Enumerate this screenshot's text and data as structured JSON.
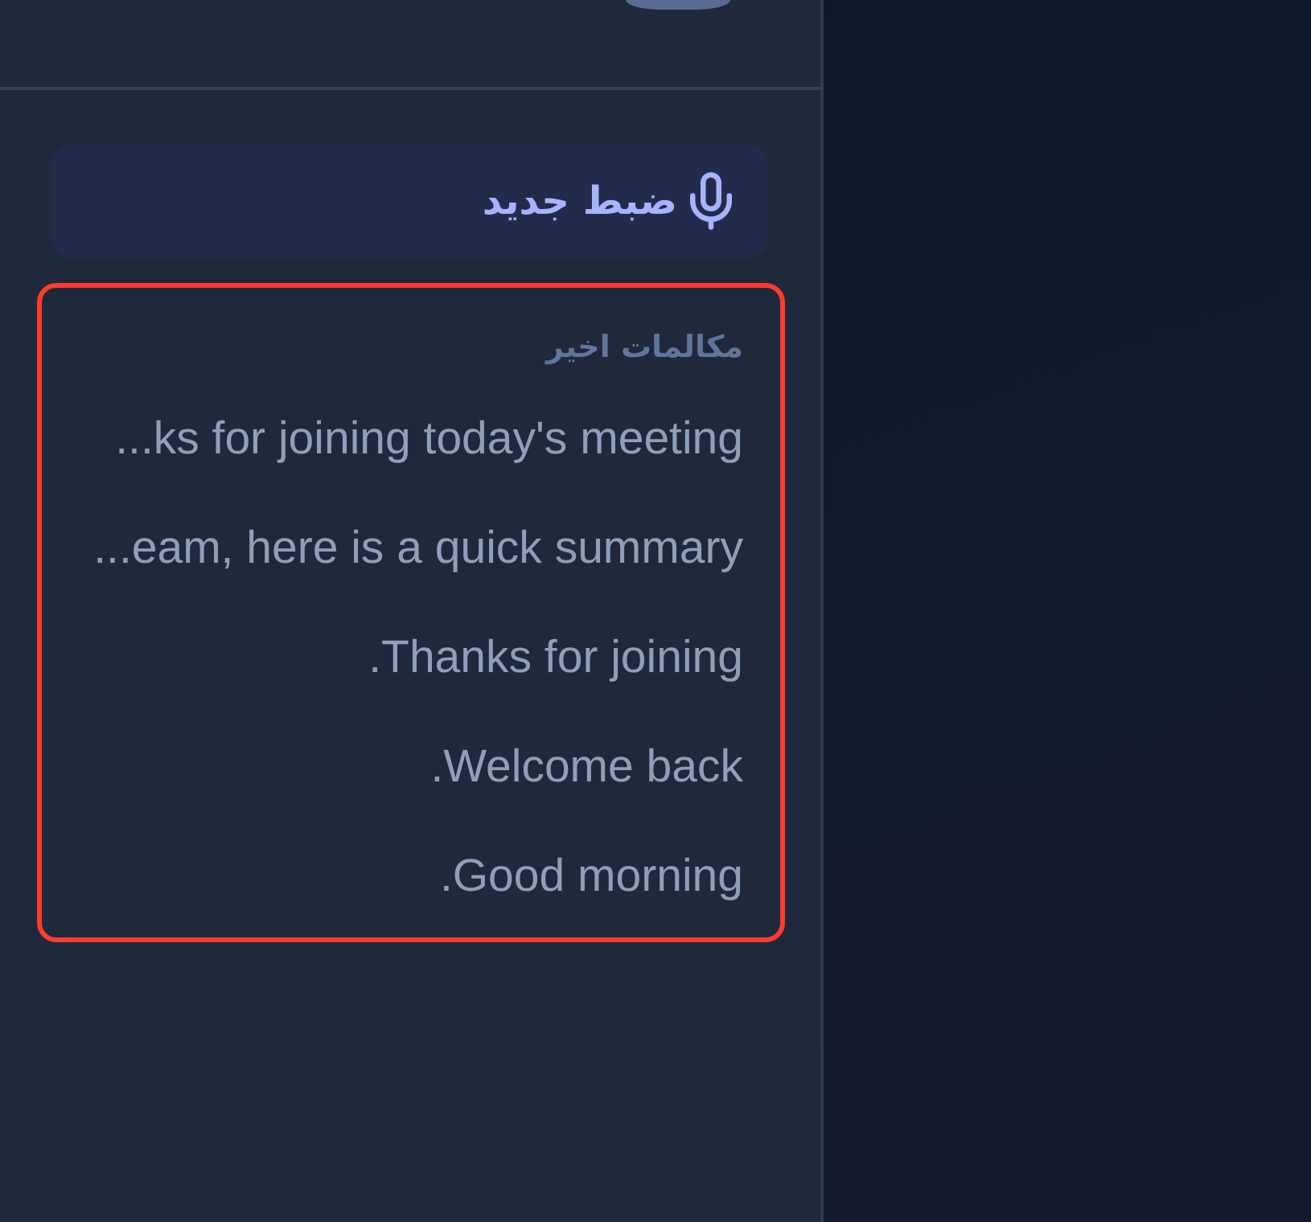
{
  "sidebar": {
    "new_recording_button": {
      "label": "ضبط جدید"
    },
    "recent_calls": {
      "title": "مکالمات اخیر",
      "highlighted": true,
      "items": [
        "...ks for joining today's meeting",
        "...eam, here is a quick summary",
        ".Thanks for joining",
        ".Welcome back",
        ".Good morning"
      ]
    }
  }
}
